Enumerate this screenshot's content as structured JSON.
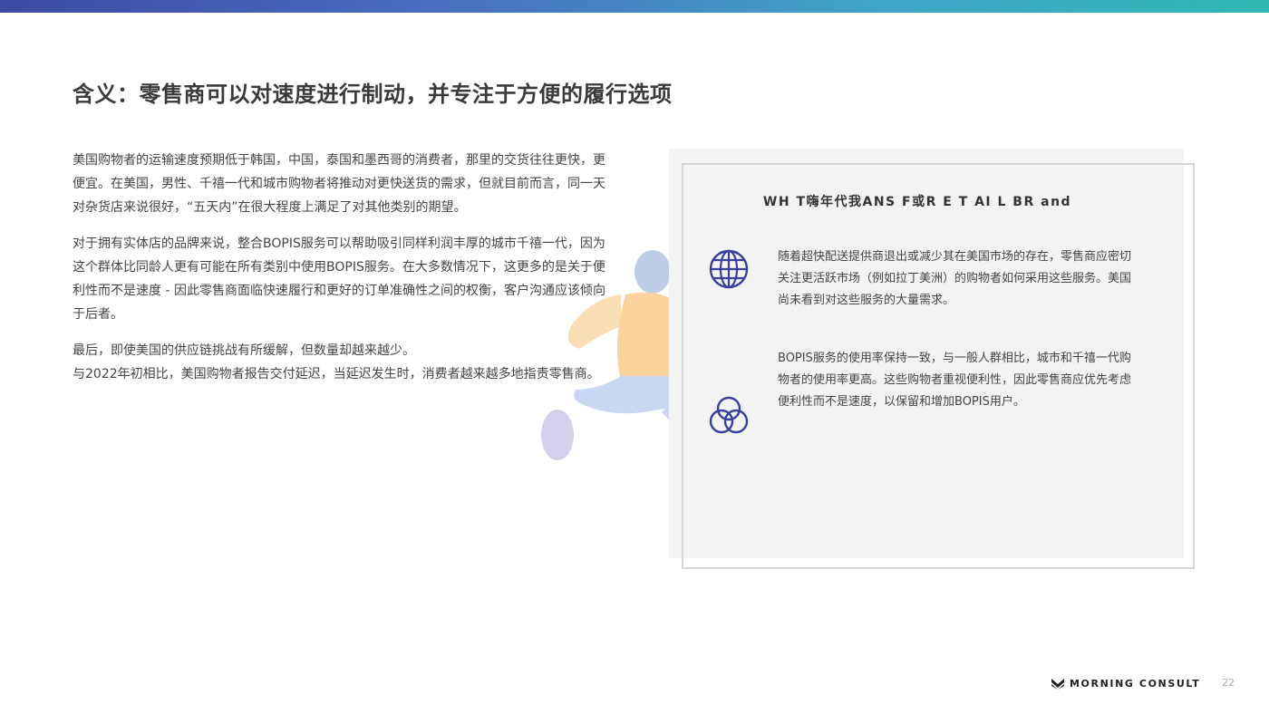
{
  "title": "含义：零售商可以对速度进行制动，并专注于方便的履行选项",
  "body": {
    "p1": "美国购物者的运输速度预期低于韩国，中国，泰国和墨西哥的消费者，那里的交货往往更快，更便宜。在美国，男性、千禧一代和城市购物者将推动对更快送货的需求，但就目前而言，同一天对杂货店来说很好，“五天内”在很大程度上满足了对其他类别的期望。",
    "p2": "对于拥有实体店的品牌来说，整合BOPIS服务可以帮助吸引同样利润丰厚的城市千禧一代，因为这个群体比同龄人更有可能在所有类别中使用BOPIS服务。在大多数情况下，这更多的是关于便利性而不是速度 - 因此零售商面临快速履行和更好的订单准确性之间的权衡，客户沟通应该倾向于后者。",
    "p3": "最后，即使美国的供应链挑战有所缓解，但数量却越来越少。",
    "p4": "与2022年初相比，美国购物者报告交付延迟，当延迟发生时，消费者越来越多地指责零售商。"
  },
  "panel": {
    "heading": "WH T嗨年代我ANS F或R E T AI L BR and",
    "items": [
      {
        "icon": "globe-icon",
        "text": "随着超快配送提供商退出或减少其在美国市场的存在，零售商应密切关注更活跃市场（例如拉丁美洲）的购物者如何采用这些服务。美国尚未看到对这些服务的大量需求。"
      },
      {
        "icon": "overlapping-circles-icon",
        "text": "BOPIS服务的使用率保持一致，与一般人群相比，城市和千禧一代购物者的使用率更高。这些购物者重视便利性，因此零售商应优先考虑便利性而不是速度，以保留和增加BOPIS用户。"
      }
    ]
  },
  "footer": {
    "brand": "MORNING CONSULT",
    "page_number": "22"
  },
  "colors": {
    "accent": "#3a3f9a",
    "bar_start": "#3b4ba5",
    "bar_end": "#2fb8b3",
    "panel_bg": "#f3f3f3"
  }
}
